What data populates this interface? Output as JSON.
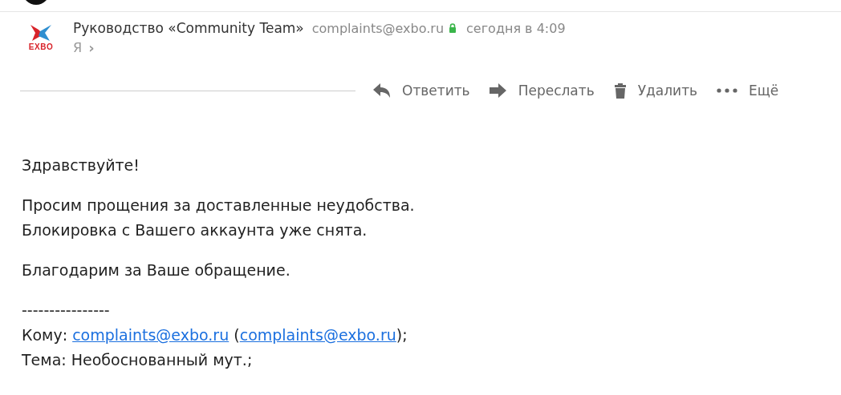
{
  "sender": {
    "logo_text": "EXBO",
    "name": "Руководство «Community Team»",
    "email": "complaints@exbo.ru",
    "secure": true,
    "time": "сегодня в 4:09",
    "recipient": "Я",
    "recipient_caret": "›"
  },
  "actions": [
    {
      "kind": "reply",
      "label": "Ответить"
    },
    {
      "kind": "forward",
      "label": "Переслать"
    },
    {
      "kind": "delete",
      "label": "Удалить"
    },
    {
      "kind": "more",
      "label": "Ещё"
    }
  ],
  "body": {
    "greeting": "Здравствуйте!",
    "paragraph_lines": [
      "Просим прощения за доставленные неудобства.",
      "Блокировка с Вашего аккаунта уже снята."
    ],
    "thanks": "Благодарим за Ваше обращение.",
    "separator": "----------------",
    "to_label": "Кому:",
    "to_link": "complaints@exbo.ru",
    "open_paren": "(",
    "to_link_2": "complaints@exbo.ru",
    "close_paren": ");",
    "subject": "Тема: Необоснованный мут.;"
  }
}
